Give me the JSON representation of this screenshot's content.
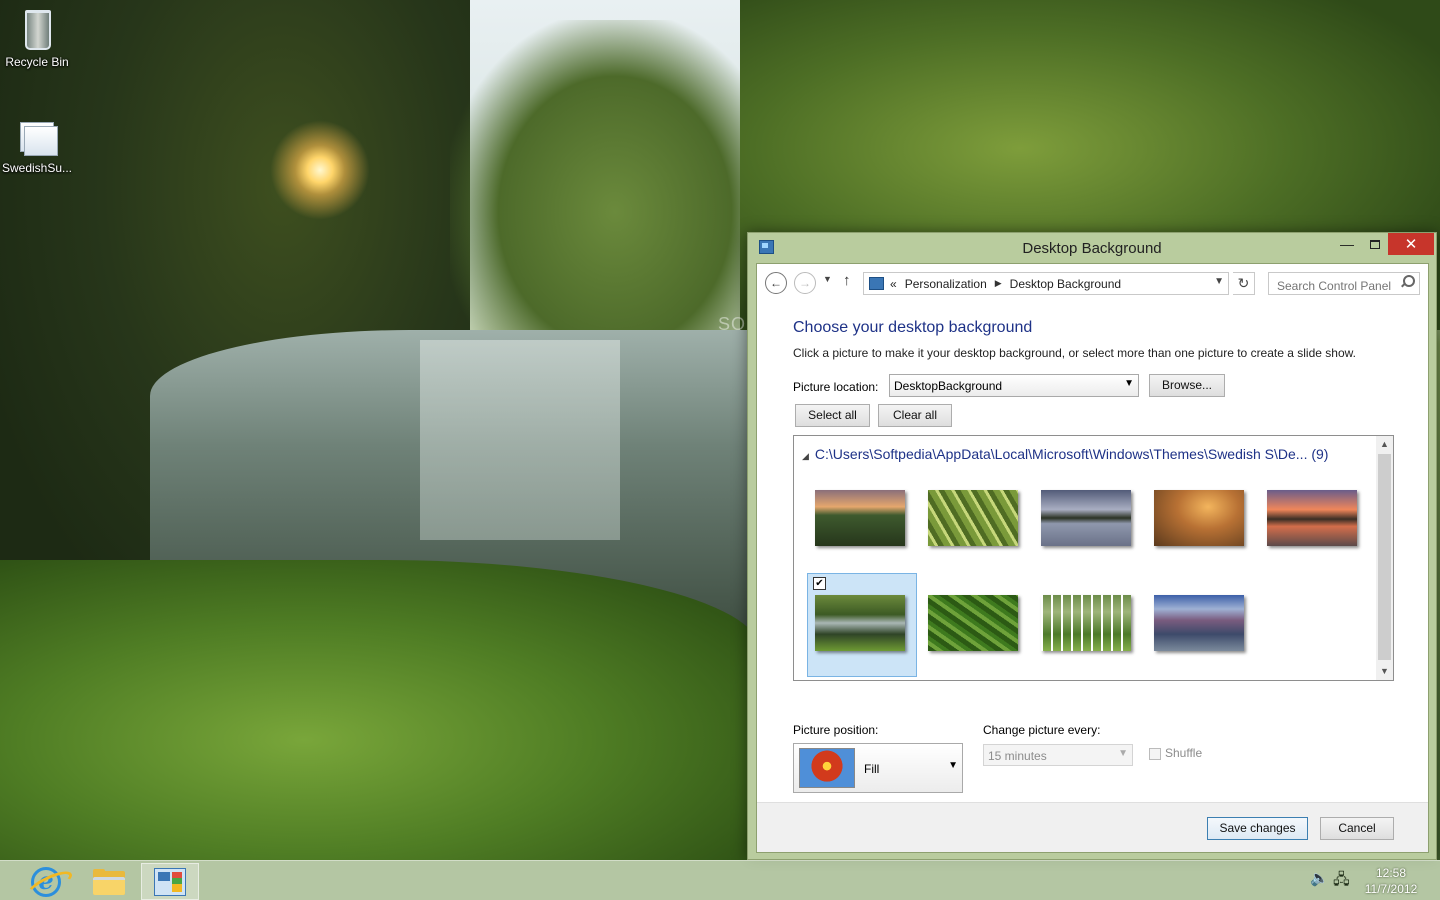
{
  "desktop": {
    "icons": [
      {
        "label": "Recycle Bin",
        "icon": "recycle-bin-icon"
      },
      {
        "label": "SwedishSu...",
        "icon": "theme-file-icon"
      }
    ],
    "watermark": "SOFTP"
  },
  "window": {
    "title": "Desktop Background",
    "controls": {
      "minimize": "—",
      "close": "✕"
    }
  },
  "address_bar": {
    "prefix": "«",
    "crumbs": [
      "Personalization",
      "Desktop Background"
    ],
    "search_placeholder": "Search Control Panel"
  },
  "content": {
    "heading": "Choose your desktop background",
    "description": "Click a picture to make it your desktop background, or select more than one picture to create a slide show.",
    "picture_location": {
      "label": "Picture location:",
      "value": "DesktopBackground"
    },
    "buttons": {
      "browse": "Browse...",
      "select_all": "Select all",
      "clear_all": "Clear all"
    },
    "picture_group": {
      "path": "C:\\Users\\Softpedia\\AppData\\Local\\Microsoft\\Windows\\Themes\\Swedish S\\De...",
      "count": "(9)",
      "thumbnails": [
        {
          "name": "swedish-sunset-forest",
          "selected": false
        },
        {
          "name": "grass-closeup",
          "selected": false
        },
        {
          "name": "lake-island-dusk",
          "selected": false
        },
        {
          "name": "heather-sunset",
          "selected": false
        },
        {
          "name": "pond-orange-sky",
          "selected": false
        },
        {
          "name": "river-reflection",
          "selected": true
        },
        {
          "name": "fern-leaves",
          "selected": false
        },
        {
          "name": "birch-grove",
          "selected": false
        },
        {
          "name": "mountain-valley",
          "selected": false
        }
      ]
    },
    "picture_position": {
      "label": "Picture position:",
      "value": "Fill"
    },
    "change_picture": {
      "label": "Change picture every:",
      "value": "15 minutes"
    },
    "shuffle": {
      "label": "Shuffle",
      "checked": false
    }
  },
  "footer": {
    "save": "Save changes",
    "cancel": "Cancel"
  },
  "taskbar": {
    "apps": [
      {
        "name": "internet-explorer",
        "active": false
      },
      {
        "name": "file-explorer",
        "active": false
      },
      {
        "name": "control-panel",
        "active": true
      }
    ],
    "clock": {
      "time": "12:58",
      "date": "11/7/2012"
    }
  }
}
